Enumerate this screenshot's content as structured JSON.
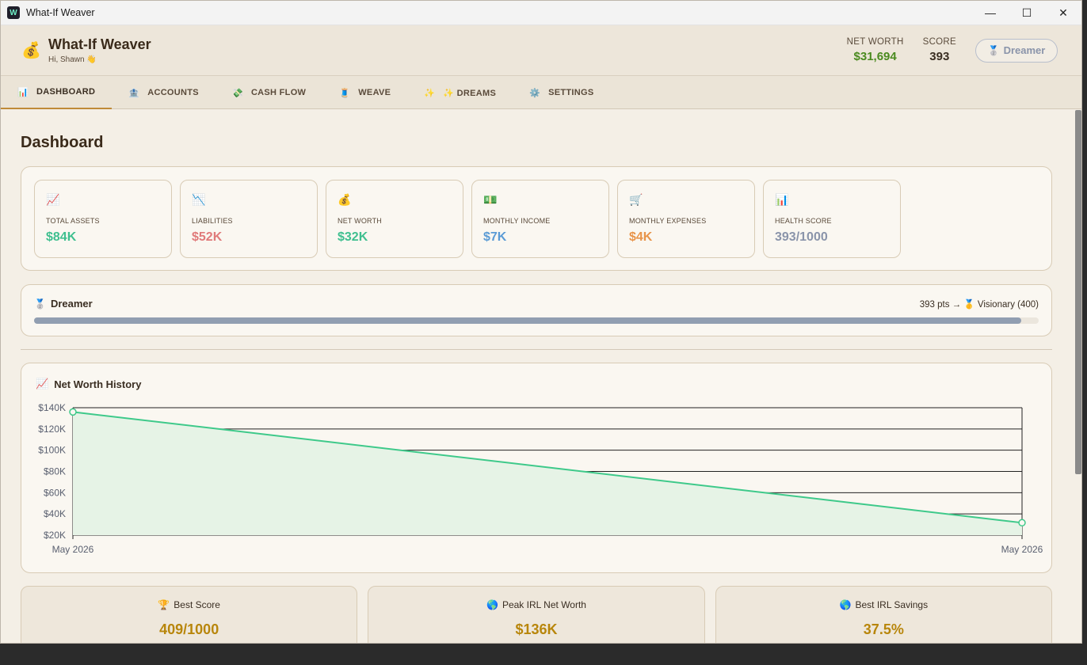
{
  "window": {
    "title": "What-If Weaver"
  },
  "header": {
    "app_name": "What-If Weaver",
    "greeting": "Hi, Shawn 👋",
    "net_worth_label": "NET WORTH",
    "net_worth_value": "$31,694",
    "score_label": "SCORE",
    "score_value": "393",
    "rank_badge": "Dreamer"
  },
  "nav": {
    "tabs": [
      {
        "icon": "📊",
        "label": "DASHBOARD",
        "active": true
      },
      {
        "icon": "🏦",
        "label": "ACCOUNTS"
      },
      {
        "icon": "💸",
        "label": "CASH FLOW"
      },
      {
        "icon": "🧵",
        "label": "WEAVE"
      },
      {
        "icon": "✨",
        "label": "✨ DREAMS"
      },
      {
        "icon": "⚙️",
        "label": "SETTINGS"
      }
    ]
  },
  "page": {
    "title": "Dashboard"
  },
  "kpis": [
    {
      "icon": "📈",
      "label": "TOTAL ASSETS",
      "value": "$84K",
      "color": "#3fbf8f"
    },
    {
      "icon": "📉",
      "label": "LIABILITIES",
      "value": "$52K",
      "color": "#e07a7a"
    },
    {
      "icon": "💰",
      "label": "NET WORTH",
      "value": "$32K",
      "color": "#3fbf8f"
    },
    {
      "icon": "💵",
      "label": "MONTHLY INCOME",
      "value": "$7K",
      "color": "#5b9bd5"
    },
    {
      "icon": "🛒",
      "label": "MONTHLY EXPENSES",
      "value": "$4K",
      "color": "#e8944a"
    },
    {
      "icon": "📊",
      "label": "HEALTH SCORE",
      "value": "393/1000",
      "color": "#8a94aa"
    }
  ],
  "rank": {
    "title": "Dreamer",
    "next": "393 pts → 🥇 Visionary (400)",
    "progress": 0.9825
  },
  "chart": {
    "title": "Net Worth History"
  },
  "chart_data": {
    "type": "area",
    "title": "Net Worth History",
    "x": [
      "May 2026",
      "May 2026"
    ],
    "y": [
      136000,
      31694
    ],
    "ylim": [
      20000,
      140000
    ],
    "y_ticks": [
      "$140K",
      "$120K",
      "$100K",
      "$80K",
      "$60K",
      "$40K",
      "$20K"
    ],
    "y_tick_values": [
      140000,
      120000,
      100000,
      80000,
      60000,
      40000,
      20000
    ],
    "x_tick_labels": [
      "May 2026",
      "May 2026"
    ],
    "grid": true,
    "line_color": "#3ec98a",
    "fill_color": "#e6f3e6"
  },
  "bottom": [
    {
      "icon": "🏆",
      "label": "Best Score",
      "value": "409/1000"
    },
    {
      "icon": "🌎",
      "label": "Peak IRL Net Worth",
      "value": "$136K"
    },
    {
      "icon": "🌎",
      "label": "Best IRL Savings",
      "value": "37.5%"
    }
  ]
}
